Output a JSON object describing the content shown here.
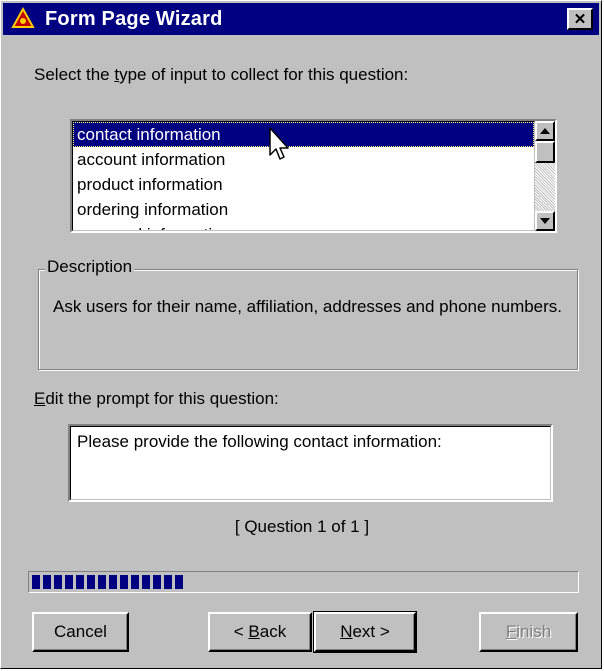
{
  "window": {
    "title": "Form Page Wizard",
    "close_glyph": "✕"
  },
  "instruction": {
    "before": "Select the ",
    "mnemonic": "t",
    "after": "ype of input to collect for this question:"
  },
  "input_types": {
    "items": [
      {
        "label": "contact information",
        "selected": true
      },
      {
        "label": "account information",
        "selected": false
      },
      {
        "label": "product information",
        "selected": false
      },
      {
        "label": "ordering information",
        "selected": false
      },
      {
        "label": "personal information",
        "selected": false
      }
    ]
  },
  "description": {
    "legend": "Description",
    "text": "Ask users for their name, affiliation, addresses and phone numbers."
  },
  "prompt": {
    "label_mnemonic": "E",
    "label_rest": "dit the prompt for this question:",
    "value": "Please provide the following contact information:"
  },
  "question_counter": "[ Question 1 of 1 ]",
  "progress": {
    "fraction": 0.28,
    "color": "#000080"
  },
  "buttons": {
    "cancel": "Cancel",
    "back_prefix": "< ",
    "back_mnemonic": "B",
    "back_rest": "ack",
    "next_mnemonic": "N",
    "next_rest": "ext >",
    "finish_mnemonic": "F",
    "finish_rest": "inish"
  },
  "icons": {
    "app": "wizard-icon",
    "cursor": "arrow-cursor-icon"
  }
}
